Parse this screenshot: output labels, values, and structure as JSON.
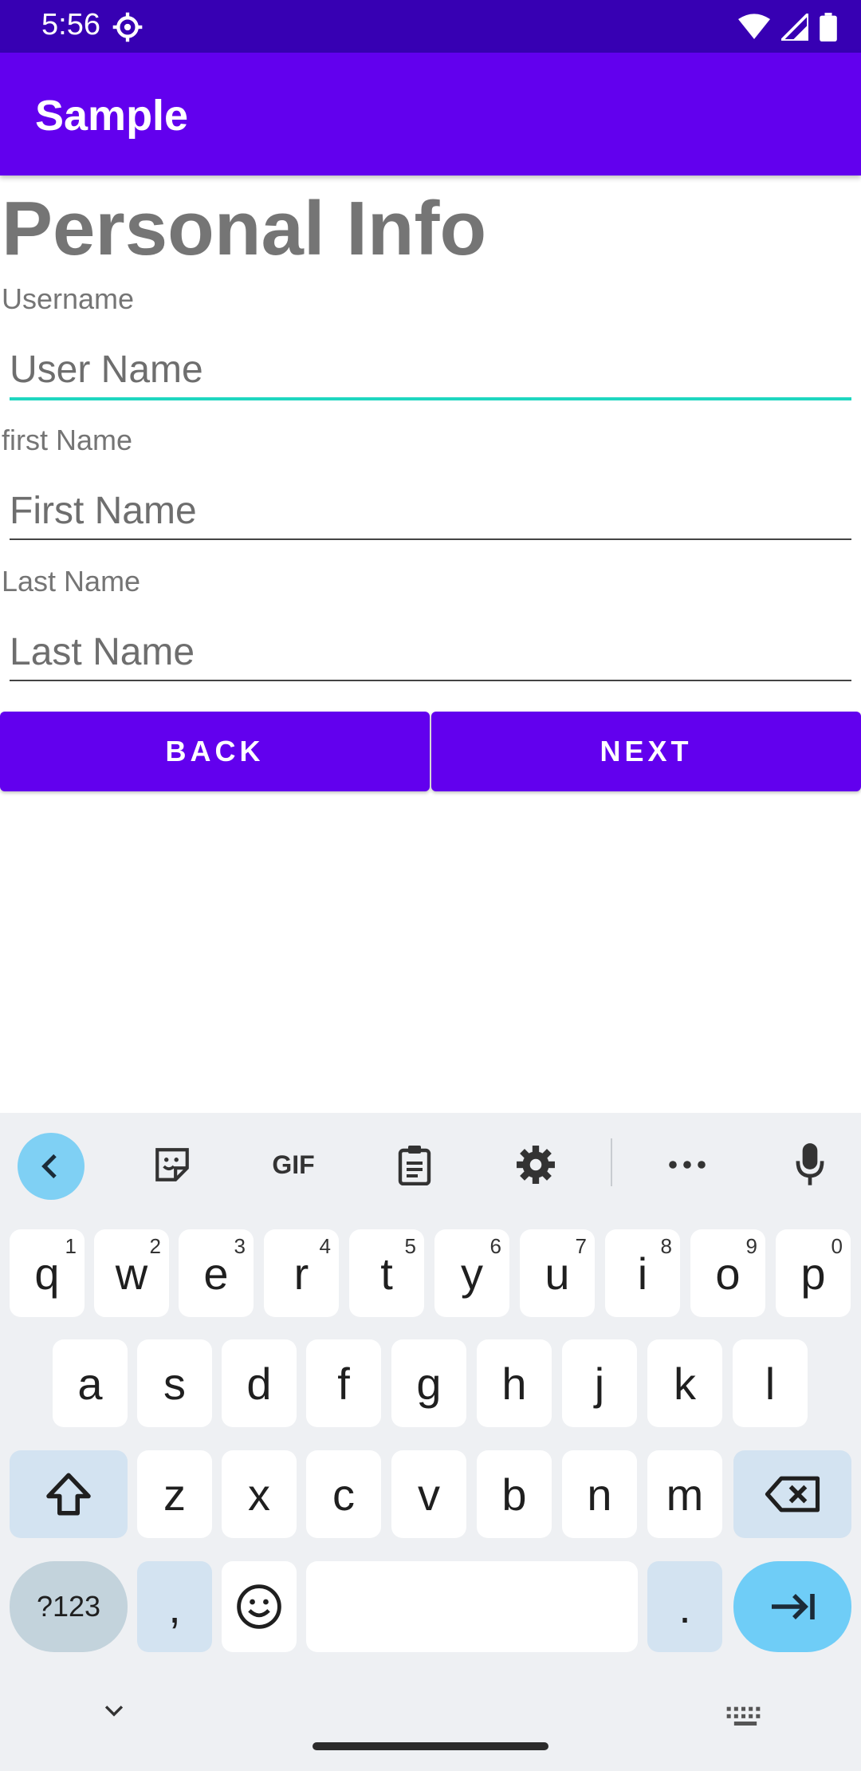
{
  "status": {
    "time": "5:56"
  },
  "app": {
    "title": "Sample"
  },
  "form": {
    "heading": "Personal Info",
    "fields": [
      {
        "label": "Username",
        "placeholder": "User Name",
        "value": "",
        "focused": true
      },
      {
        "label": "first Name",
        "placeholder": "First Name",
        "value": "",
        "focused": false
      },
      {
        "label": "Last Name",
        "placeholder": "Last Name",
        "value": "",
        "focused": false
      }
    ],
    "back_label": "BACK",
    "next_label": "NEXT"
  },
  "keyboard": {
    "toolbar": [
      "back-icon",
      "sticker-icon",
      "gif-icon",
      "clipboard-icon",
      "gear-icon",
      "more-icon",
      "mic-icon"
    ],
    "gif_label": "GIF",
    "row1": [
      {
        "k": "q",
        "n": "1"
      },
      {
        "k": "w",
        "n": "2"
      },
      {
        "k": "e",
        "n": "3"
      },
      {
        "k": "r",
        "n": "4"
      },
      {
        "k": "t",
        "n": "5"
      },
      {
        "k": "y",
        "n": "6"
      },
      {
        "k": "u",
        "n": "7"
      },
      {
        "k": "i",
        "n": "8"
      },
      {
        "k": "o",
        "n": "9"
      },
      {
        "k": "p",
        "n": "0"
      }
    ],
    "row2": [
      "a",
      "s",
      "d",
      "f",
      "g",
      "h",
      "j",
      "k",
      "l"
    ],
    "row3": [
      "z",
      "x",
      "c",
      "v",
      "b",
      "n",
      "m"
    ],
    "sym_label": "?123",
    "comma": ",",
    "period": "."
  },
  "colors": {
    "status_bar": "#3700b3",
    "primary": "#6200ee",
    "focus_underline": "#1fd6c0",
    "enter_key": "#6fcdf7"
  }
}
